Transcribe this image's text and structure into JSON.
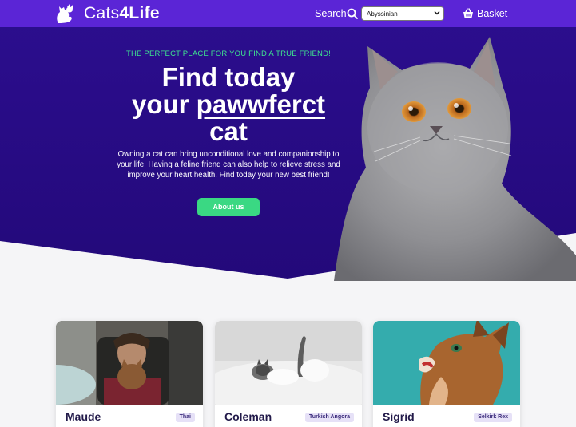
{
  "navbar": {
    "brand": {
      "name_regular": "Cats",
      "name_bold": "4Life",
      "icon": "cat-logo-icon"
    },
    "search_label": "Search",
    "search_icon": "magnifier-icon",
    "breed_select": {
      "selected": "Abyssinian"
    },
    "basket_label": "Basket",
    "basket_icon": "basket-icon",
    "color": "#5b25d6"
  },
  "hero": {
    "tagline": "THE PERFECT PLACE FOR YOU FIND A TRUE FRIEND!",
    "headline_line1": "Find today",
    "headline_your": "your",
    "headline_pawwferct": "pawwferct",
    "headline_line3": "cat",
    "lead": "Owning a cat can bring unconditional love and companionship to your life. Having a feline friend can also help to relieve stress and improve your heart health. Find today your new best friend!",
    "cta_label": "About us",
    "colors": {
      "background": "#2a0c8c",
      "accent": "#3ee38f",
      "button": "#3ad883"
    }
  },
  "cats": [
    {
      "name": "Maude",
      "breed": "Thai"
    },
    {
      "name": "Coleman",
      "breed": "Turkish Angora"
    },
    {
      "name": "Sigrid",
      "breed": "Selkirk Rex"
    }
  ]
}
